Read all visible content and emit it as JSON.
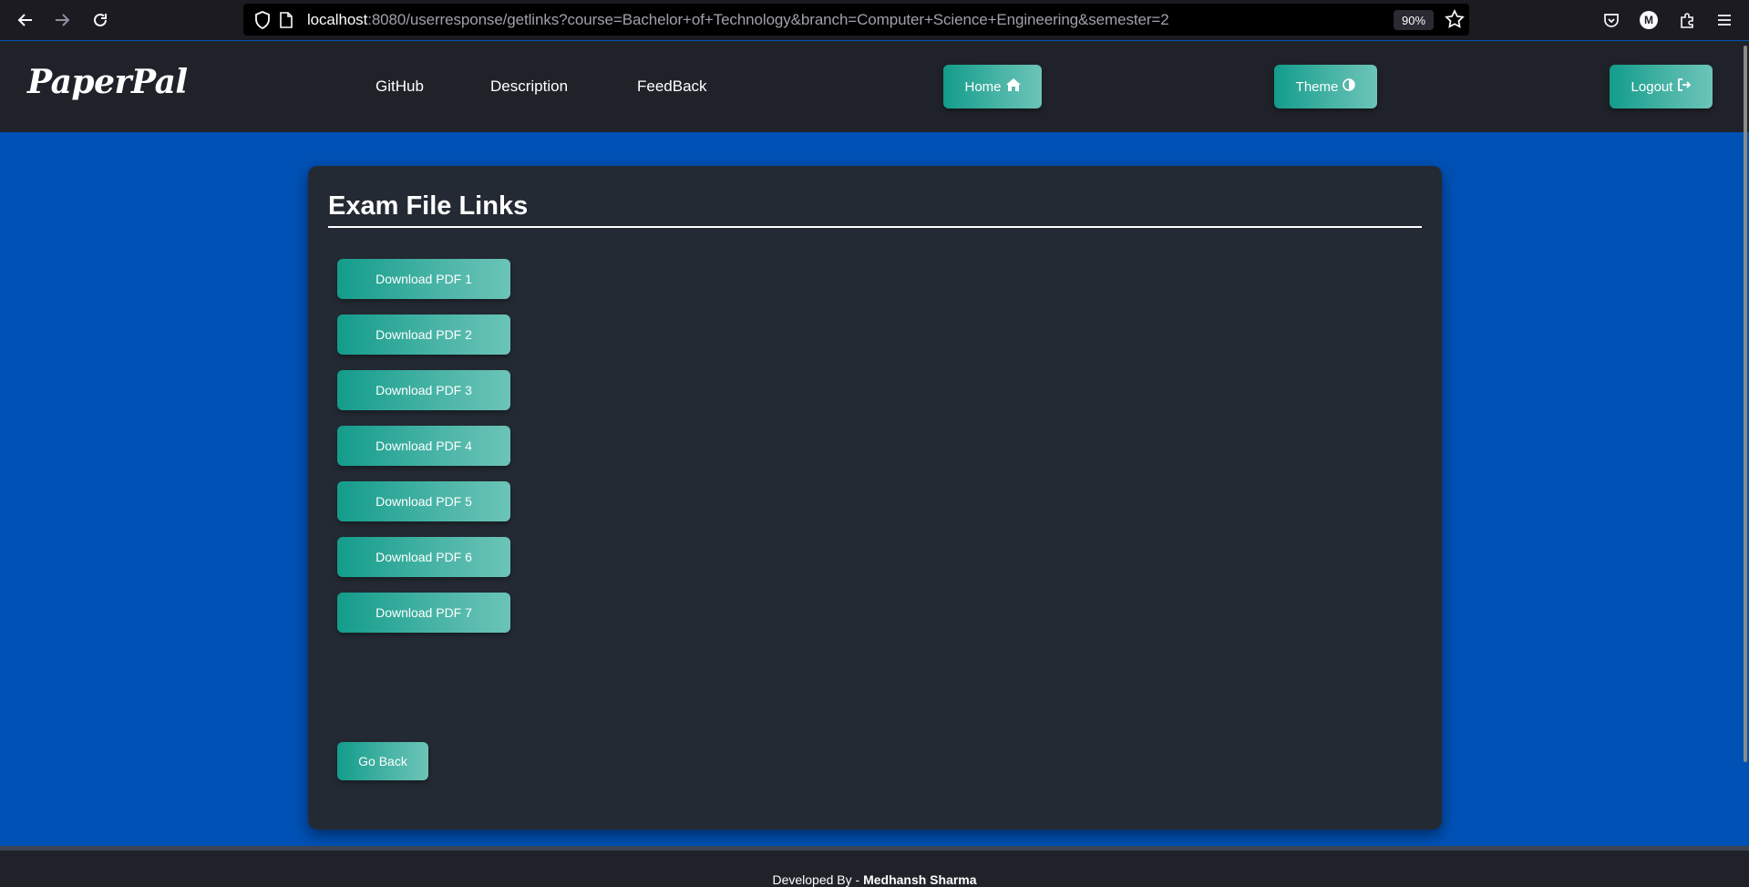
{
  "browser": {
    "url_host": "localhost",
    "url_rest": ":8080/userresponse/getlinks?course=Bachelor+of+Technology&branch=Computer+Science+Engineering&semester=2",
    "zoom": "90%",
    "profile_initial": "M"
  },
  "header": {
    "logo": "PaperPal",
    "nav": [
      "GitHub",
      "Description",
      "FeedBack"
    ],
    "home_label": "Home",
    "theme_label": "Theme",
    "logout_label": "Logout"
  },
  "main": {
    "title": "Exam File Links",
    "pdf_links": [
      "Download PDF 1",
      "Download PDF 2",
      "Download PDF 3",
      "Download PDF 4",
      "Download PDF 5",
      "Download PDF 6",
      "Download PDF 7"
    ],
    "go_back_label": "Go Back"
  },
  "footer": {
    "prefix": "Developed By - ",
    "author": "Medhansh Sharma"
  },
  "colors": {
    "page_bg": "#0051b5",
    "header_bg": "#1f2329",
    "card_bg": "#242a34",
    "button_teal": "#139c8b"
  }
}
